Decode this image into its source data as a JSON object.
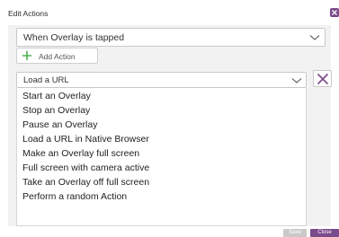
{
  "dialog": {
    "title": "Edit Actions"
  },
  "trigger": {
    "selected": "When Overlay is tapped"
  },
  "add_action": {
    "label": "Add Action"
  },
  "action": {
    "selected": "Load a URL",
    "options": [
      "Start an Overlay",
      "Stop an Overlay",
      "Pause an Overlay",
      "Load a URL in Native Browser",
      "Make an Overlay full screen",
      "Full screen with camera active",
      "Take an Overlay off full screen",
      "Perform a random Action"
    ]
  },
  "footer": {
    "save_label": "Save",
    "close_label": "Close"
  },
  "colors": {
    "accent_purple": "#7b4a8a",
    "add_green": "#4caf50",
    "remove_purple": "#7b4a8a"
  },
  "icons": {
    "close": "close-icon",
    "chevron": "chevron-down-icon",
    "plus": "plus-icon",
    "remove": "remove-x-icon"
  }
}
